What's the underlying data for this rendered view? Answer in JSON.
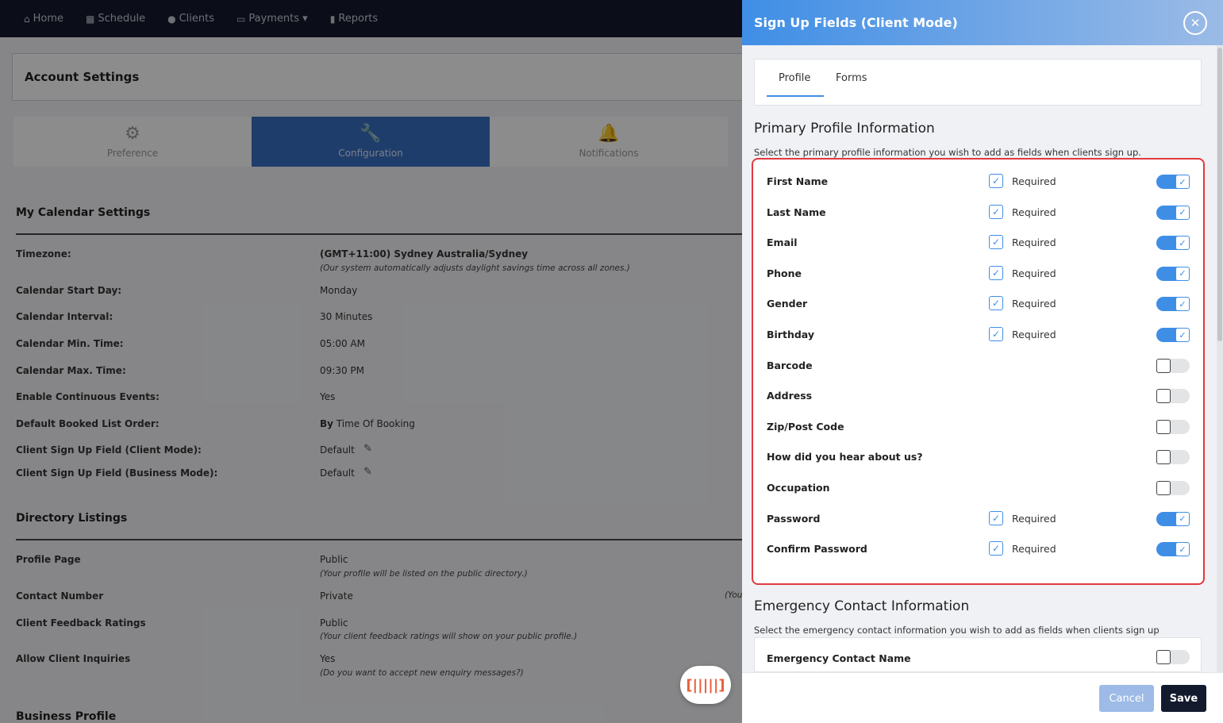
{
  "nav": {
    "items": [
      {
        "label": "Home",
        "icon": "home-icon",
        "glyph": "⌂"
      },
      {
        "label": "Schedule",
        "icon": "calendar-icon",
        "glyph": "▦"
      },
      {
        "label": "Clients",
        "icon": "user-icon",
        "glyph": "●"
      },
      {
        "label": "Payments ▾",
        "icon": "credit-card-icon",
        "glyph": "▭"
      },
      {
        "label": "Reports",
        "icon": "bar-chart-icon",
        "glyph": "▮"
      }
    ]
  },
  "account": {
    "title": "Account Settings",
    "tabs": [
      {
        "label": "Preference",
        "icon": "gear-icon",
        "glyph": "⚙"
      },
      {
        "label": "Configuration",
        "icon": "wrench-icon",
        "glyph": "🔧"
      },
      {
        "label": "Notifications",
        "icon": "bell-icon",
        "glyph": "🔔"
      }
    ]
  },
  "calendar": {
    "title": "My Calendar Settings",
    "timezone_label": "Timezone:",
    "timezone_value": "(GMT+11:00) Sydney Australia/Sydney",
    "timezone_note": "(Our system automatically adjusts daylight savings time across all zones.)",
    "start_day_label": "Calendar Start Day:",
    "start_day_value": "Monday",
    "interval_label": "Calendar Interval:",
    "interval_value": "30 Minutes",
    "min_time_label": "Calendar Min. Time:",
    "min_time_value": "05:00 AM",
    "max_time_label": "Calendar Max. Time:",
    "max_time_value": "09:30 PM",
    "continuous_label": "Enable Continuous Events:",
    "continuous_value": "Yes",
    "booked_order_label": "Default Booked List Order:",
    "booked_order_prefix": "By",
    "booked_order_value": "Time Of Booking",
    "signup_client_label": "Client Sign Up Field (Client Mode):",
    "signup_client_value": "Default",
    "signup_business_label": "Client Sign Up Field (Business Mode):",
    "signup_business_value": "Default"
  },
  "directory": {
    "title": "Directory Listings",
    "profile_label": "Profile Page",
    "profile_value": "Public",
    "profile_note": "(Your profile will be listed on the public directory.)",
    "contact_label": "Contact Number",
    "contact_value": "Private",
    "contact_note_fragment": "(You",
    "feedback_label": "Client Feedback Ratings",
    "feedback_value": "Public",
    "feedback_note": "(Your client feedback ratings will show on your public profile.)",
    "inquiries_label": "Allow Client Inquiries",
    "inquiries_value": "Yes",
    "inquiries_note": "(Do you want to accept new enquiry messages?)"
  },
  "business": {
    "title": "Business Profile"
  },
  "modal": {
    "title": "Sign Up Fields (Client Mode)",
    "tabs": [
      "Profile",
      "Forms"
    ],
    "primary_title": "Primary Profile Information",
    "primary_sub": "Select the primary profile information you wish to add as fields when clients sign up.",
    "required_label": "Required",
    "fields": [
      {
        "label": "First Name",
        "required": true,
        "enabled": true
      },
      {
        "label": "Last Name",
        "required": true,
        "enabled": true
      },
      {
        "label": "Email",
        "required": true,
        "enabled": true
      },
      {
        "label": "Phone",
        "required": true,
        "enabled": true
      },
      {
        "label": "Gender",
        "required": true,
        "enabled": true
      },
      {
        "label": "Birthday",
        "required": true,
        "enabled": true
      },
      {
        "label": "Barcode",
        "required": false,
        "enabled": false
      },
      {
        "label": "Address",
        "required": false,
        "enabled": false
      },
      {
        "label": "Zip/Post Code",
        "required": false,
        "enabled": false
      },
      {
        "label": "How did you hear about us?",
        "required": false,
        "enabled": false
      },
      {
        "label": "Occupation",
        "required": false,
        "enabled": false
      },
      {
        "label": "Password",
        "required": true,
        "enabled": true
      },
      {
        "label": "Confirm Password",
        "required": true,
        "enabled": true
      }
    ],
    "emergency_title": "Emergency Contact Information",
    "emergency_sub": "Select the emergency contact information you wish to add as fields when clients sign up",
    "emergency_fields": [
      {
        "label": "Emergency Contact Name",
        "enabled": false
      }
    ],
    "cancel_label": "Cancel",
    "save_label": "Save"
  },
  "colors": {
    "accent": "#3f8ee6",
    "nav_bg": "#141a2e",
    "highlight_border": "#e03a3e",
    "scan_icon": "#e8603c"
  }
}
